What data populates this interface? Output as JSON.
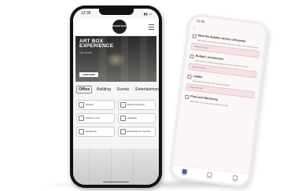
{
  "left_phone": {
    "status_time": "12:35",
    "logo_text": "EVENT BOX",
    "hero": {
      "title": "ART BOX EXPERIENCE",
      "subtitle": "SEE MORE",
      "button": "SHOP NOW"
    },
    "tabs": [
      "Office",
      "Building",
      "Events",
      "Entertainment"
    ],
    "tiles": [
      {
        "label": "Access",
        "icon": "key-icon"
      },
      {
        "label": "School reception",
        "icon": "reception-icon"
      },
      {
        "label": "Delivery zone",
        "icon": "truck-icon"
      },
      {
        "label": "Helpdesk",
        "icon": "headset-icon"
      },
      {
        "label": "Newsletter",
        "icon": "mail-icon"
      },
      {
        "label": "Promotions for tenants",
        "icon": "tag-icon"
      }
    ]
  },
  "right_phone": {
    "status_time": "12:35",
    "items": [
      {
        "title": "Meet the Netafim factory orthopedic",
        "desc": "Description of the item that explains the topic shown in this card of the list.",
        "answer": "Answer for you"
      },
      {
        "title": "Budget / architecture",
        "desc": "Description of the item that explains the topic shown in this card.",
        "answer": "Answer for you"
      },
      {
        "title": "Ladder",
        "desc": "Description of the item that explains the topic.",
        "answer": "Answer for you"
      },
      {
        "title": "Plant and Machinery",
        "desc": "Description of the item shown here in the card.",
        "answer": ""
      }
    ],
    "tabbar": [
      "Home",
      "Services",
      "Profile"
    ]
  }
}
